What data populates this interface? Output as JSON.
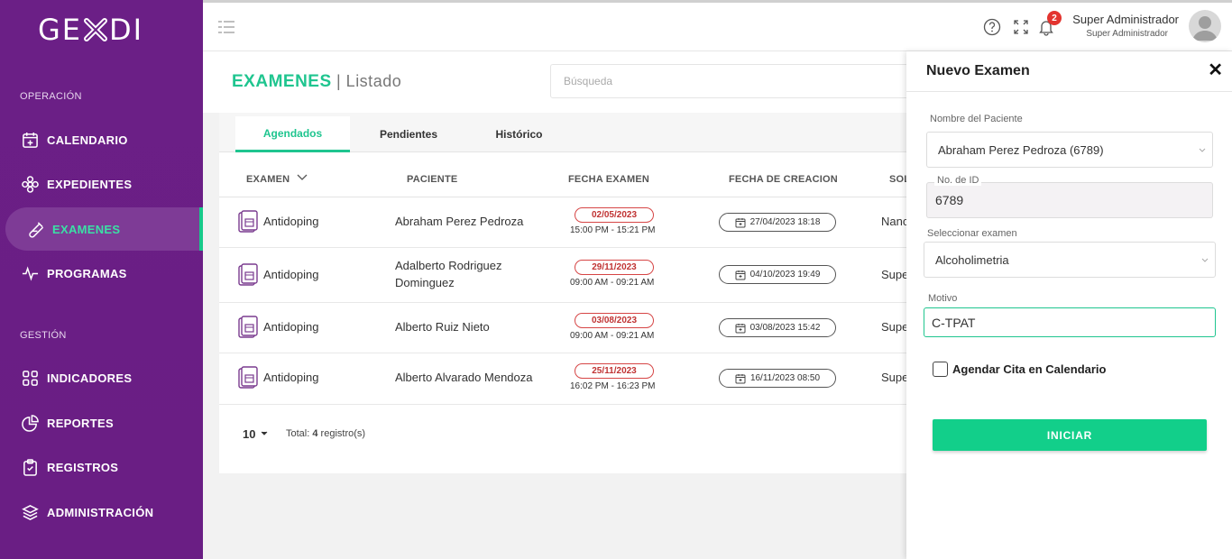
{
  "brand": {
    "logo_left": "GE",
    "logo_right": "DI"
  },
  "sidebar": {
    "sections": [
      {
        "label": "OPERACIÓN"
      },
      {
        "label": "GESTIÓN"
      }
    ],
    "items": [
      {
        "label": "CALENDARIO",
        "icon": "calendar-plus-icon"
      },
      {
        "label": "EXPEDIENTES",
        "icon": "flower-icon"
      },
      {
        "label": "EXAMENES",
        "icon": "test-tube-icon",
        "active": true
      },
      {
        "label": "PROGRAMAS",
        "icon": "pulse-icon"
      },
      {
        "label": "INDICADORES",
        "icon": "grid-icon"
      },
      {
        "label": "REPORTES",
        "icon": "pie-chart-icon"
      },
      {
        "label": "REGISTROS",
        "icon": "clipboard-check-icon"
      },
      {
        "label": "ADMINISTRACIÓN",
        "icon": "layers-icon"
      }
    ]
  },
  "topbar": {
    "notification_count": "2",
    "user_name": "Super Administrador",
    "user_role": "Super Administrador"
  },
  "header": {
    "title": "EXAMENES",
    "subtitle": "| Listado",
    "search_placeholder": "Búsqueda"
  },
  "tabs": [
    {
      "label": "Agendados",
      "active": true
    },
    {
      "label": "Pendientes"
    },
    {
      "label": "Histórico"
    }
  ],
  "table": {
    "columns": [
      "EXAMEN",
      "PACIENTE",
      "FECHA EXAMEN",
      "FECHA DE CREACION",
      "SOL"
    ],
    "rows": [
      {
        "exam": "Antidoping",
        "patient_line1": "Abraham Perez Pedroza",
        "patient_line2": "",
        "date": "02/05/2023",
        "time": "15:00 PM - 15:21 PM",
        "created": "27/04/2023 18:18",
        "requester": "Nanc"
      },
      {
        "exam": "Antidoping",
        "patient_line1": "Adalberto Rodriguez",
        "patient_line2": "Dominguez",
        "date": "29/11/2023",
        "time": "09:00 AM - 09:21 AM",
        "created": "04/10/2023 19:49",
        "requester": "Supe"
      },
      {
        "exam": "Antidoping",
        "patient_line1": "Alberto Ruiz Nieto",
        "patient_line2": "",
        "date": "03/08/2023",
        "time": "09:00 AM - 09:21 AM",
        "created": "03/08/2023 15:42",
        "requester": "Supe"
      },
      {
        "exam": "Antidoping",
        "patient_line1": "Alberto Alvarado Mendoza",
        "patient_line2": "",
        "date": "25/11/2023",
        "time": "16:02 PM - 16:23 PM",
        "created": "16/11/2023 08:50",
        "requester": "Supe"
      }
    ],
    "page_size": "10",
    "total_prefix": "Total: ",
    "total_count": "4",
    "total_suffix": " registro(s)"
  },
  "panel": {
    "title": "Nuevo Examen",
    "close": "✕",
    "patient_label": "Nombre del Paciente",
    "patient_value": "Abraham Perez Pedroza (6789)",
    "id_label": "No. de ID",
    "id_value": "6789",
    "exam_label": "Seleccionar examen",
    "exam_value": "Alcoholimetria",
    "reason_label": "Motivo",
    "reason_value": "C-TPAT",
    "checkbox_label": "Agendar Cita en Calendario",
    "submit_label": "INICIAR"
  },
  "colors": {
    "sidebar": "#6b1f86",
    "accent": "#1fc58f",
    "button": "#12cf8a",
    "danger": "#d64545"
  }
}
